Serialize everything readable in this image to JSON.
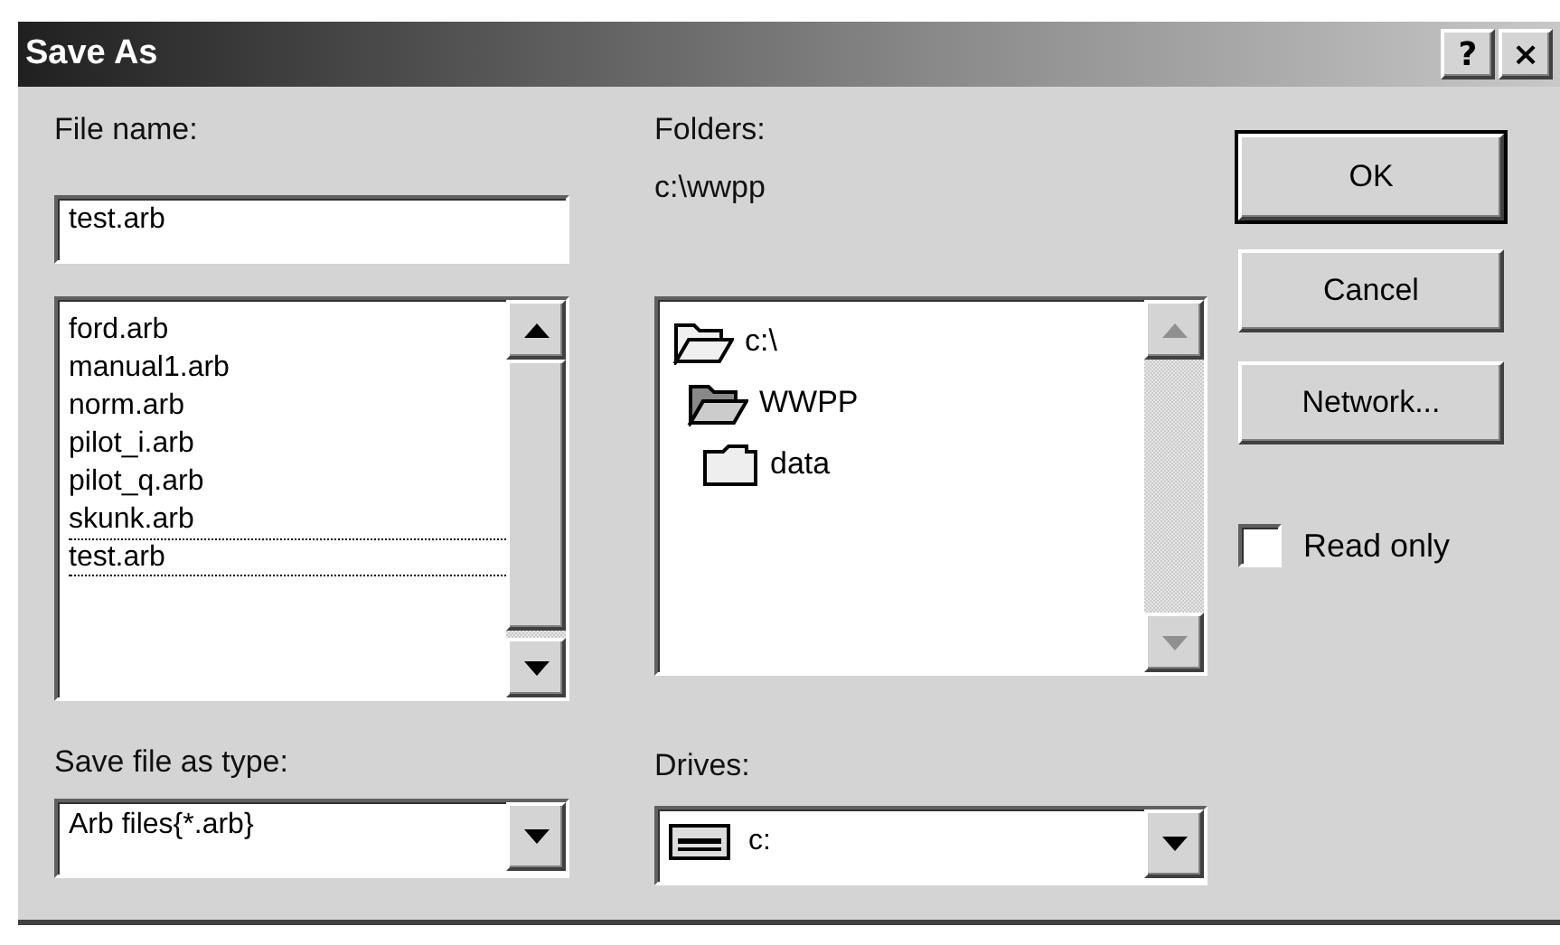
{
  "window": {
    "title": "Save As",
    "title_buttons": [
      "?",
      "×"
    ]
  },
  "file_name": {
    "label": "File name:",
    "value": "test.arb"
  },
  "files": [
    {
      "name": "ford.arb",
      "selected": false
    },
    {
      "name": "manual1.arb",
      "selected": false
    },
    {
      "name": "norm.arb",
      "selected": false
    },
    {
      "name": "pilot_i.arb",
      "selected": false
    },
    {
      "name": "pilot_q.arb",
      "selected": false
    },
    {
      "name": "skunk.arb",
      "selected": false
    },
    {
      "name": "test.arb",
      "selected": true
    }
  ],
  "folders": {
    "label": "Folders:",
    "path": "c:\\wwpp",
    "tree": [
      {
        "name": "c:\\",
        "kind": "open",
        "children": [
          {
            "name": "WWPP",
            "kind": "current",
            "children": [
              {
                "name": "data",
                "kind": "closed"
              }
            ]
          }
        ]
      }
    ]
  },
  "file_type": {
    "label": "Save file as type:",
    "value": "Arb files{*.arb}"
  },
  "drives": {
    "label": "Drives:",
    "value": "c:"
  },
  "buttons": [
    {
      "label": "OK",
      "default": true
    },
    {
      "label": "Cancel",
      "default": false
    },
    {
      "label": "Network...",
      "default": false
    }
  ],
  "read_only": {
    "label": "Read only",
    "checked": false
  }
}
